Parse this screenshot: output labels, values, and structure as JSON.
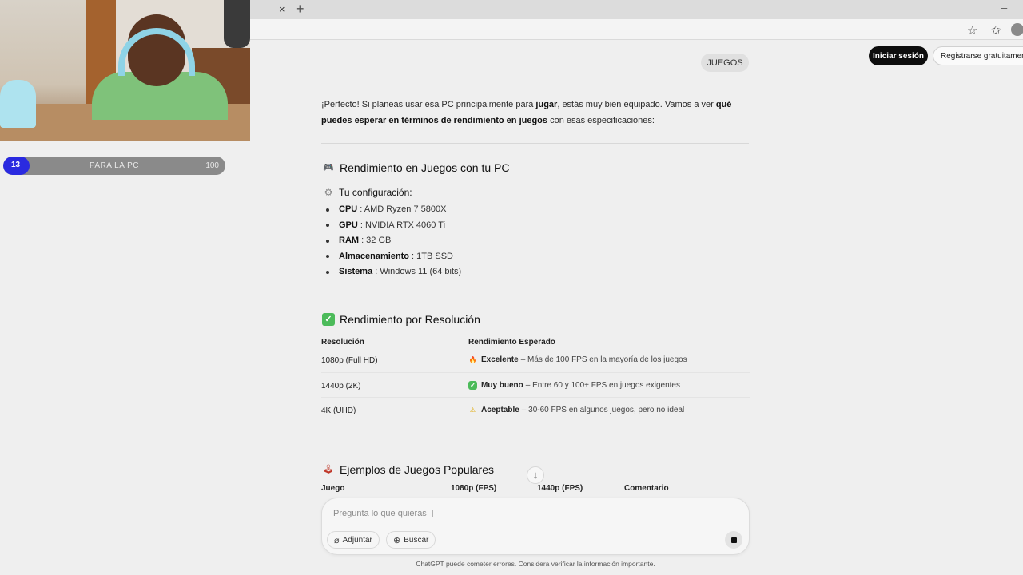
{
  "browser": {
    "close_tab_icon": "close-icon",
    "close_glyph": "×",
    "new_tab_glyph": "+",
    "minimize_glyph": "–",
    "star_glyph": "☆",
    "favorites_glyph": "✩"
  },
  "overlay": {
    "progress": {
      "start": "13",
      "label": "PARA LA PC",
      "end": "100",
      "fraction": 0.12
    }
  },
  "header": {
    "login_label": "Iniciar sesión",
    "register_label": "Registrarse gratuitamente"
  },
  "chat": {
    "user_message": "JUEGOS",
    "intro": {
      "p1": "¡Perfecto! Si planeas usar esa PC principalmente para ",
      "b1": "jugar",
      "p2": ", estás muy bien equipado. Vamos a ver ",
      "b2": "qué puedes esperar en términos de rendimiento en juegos",
      "p3": " con esas especificaciones:"
    },
    "section1": {
      "icon": "game-controller-icon",
      "icon_glyph": "🎮",
      "title": "Rendimiento en Juegos con tu PC",
      "sub_icon": "gear-icon",
      "sub_glyph": "⚙",
      "subtitle": "Tu configuración:",
      "specs": [
        {
          "key": "CPU",
          "value": ": AMD Ryzen 7 5800X"
        },
        {
          "key": "GPU",
          "value": ": NVIDIA RTX 4060 Ti"
        },
        {
          "key": "RAM",
          "value": ": 32 GB"
        },
        {
          "key": "Almacenamiento",
          "value": ": 1TB SSD"
        },
        {
          "key": "Sistema",
          "value": ": Windows 11 (64 bits)"
        }
      ]
    },
    "section2": {
      "icon": "check-mark-icon",
      "icon_glyph": "✓",
      "title": "Rendimiento por Resolución",
      "headers": [
        "Resolución",
        "Rendimiento Esperado"
      ],
      "rows": [
        {
          "res": "1080p (Full HD)",
          "icon": "fire-icon",
          "glyph": "🔥",
          "rating": "Excelente",
          "desc": "– Más de 100 FPS en la mayoría de los juegos"
        },
        {
          "res": "1440p (2K)",
          "icon": "check-mark-icon",
          "glyph": "✓",
          "rating": "Muy bueno",
          "desc": "– Entre 60 y 100+ FPS en juegos exigentes"
        },
        {
          "res": "4K (UHD)",
          "icon": "warning-icon",
          "glyph": "⚠",
          "rating": "Aceptable",
          "desc": "– 30-60 FPS en algunos juegos, pero no ideal"
        }
      ]
    },
    "section3": {
      "icon": "joystick-icon",
      "icon_glyph": "🕹",
      "title": "Ejemplos de Juegos Populares",
      "headers": [
        "Juego",
        "1080p (FPS)",
        "1440p (FPS)",
        "Comentario"
      ]
    },
    "scroll_glyph": "↓"
  },
  "composer": {
    "placeholder": "Pregunta lo que quieras",
    "caret": "I",
    "attach_label": "Adjuntar",
    "attach_glyph": "⌀",
    "search_label": "Buscar",
    "search_glyph": "⊕",
    "disclaimer": "ChatGPT puede cometer errores. Considera verificar la información importante."
  },
  "colors": {
    "accent_progress": "#2a2ae0",
    "login_bg": "#0d0d0d",
    "check_green": "#4cbb5a",
    "fire_orange": "#f07a25",
    "warning_yellow": "#f2c230"
  }
}
